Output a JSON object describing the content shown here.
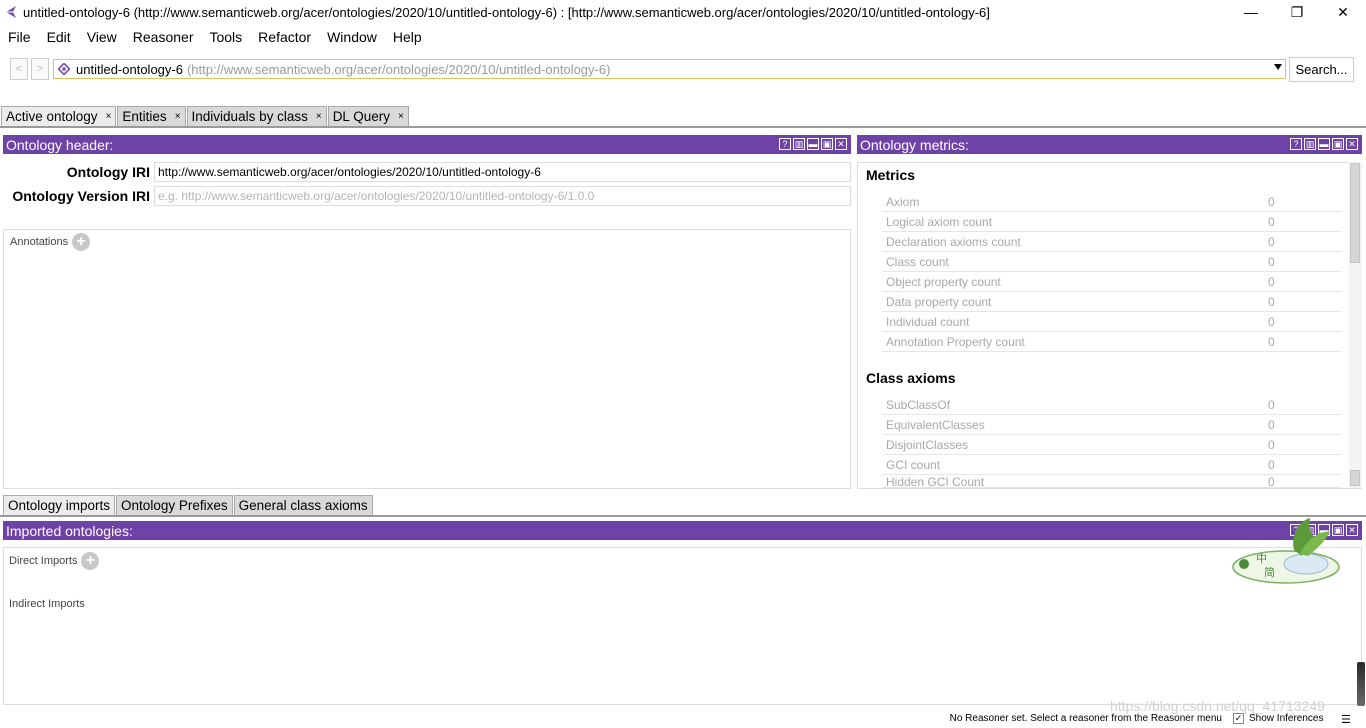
{
  "window": {
    "title": "untitled-ontology-6 (http://www.semanticweb.org/acer/ontologies/2020/10/untitled-ontology-6)  : [http://www.semanticweb.org/acer/ontologies/2020/10/untitled-ontology-6]",
    "controls": {
      "minimize": "—",
      "restore": "❐",
      "close": "✕"
    }
  },
  "menu": [
    "File",
    "Edit",
    "View",
    "Reasoner",
    "Tools",
    "Refactor",
    "Window",
    "Help"
  ],
  "nav": {
    "back": "<",
    "forward": ">",
    "ontology_name": "untitled-ontology-6",
    "ontology_iri": "(http://www.semanticweb.org/acer/ontologies/2020/10/untitled-ontology-6)",
    "search_label": "Search..."
  },
  "tabs": [
    {
      "label": "Active ontology",
      "close": "×"
    },
    {
      "label": "Entities",
      "close": "×"
    },
    {
      "label": "Individuals by class",
      "close": "×"
    },
    {
      "label": "DL Query",
      "close": "×"
    }
  ],
  "header_panel": {
    "title": "Ontology header:",
    "iri_label": "Ontology IRI",
    "iri_value": "http://www.semanticweb.org/acer/ontologies/2020/10/untitled-ontology-6",
    "version_label": "Ontology Version IRI",
    "version_placeholder": "e.g. http://www.semanticweb.org/acer/ontologies/2020/10/untitled-ontology-6/1.0.0",
    "annotations_label": "Annotations"
  },
  "metrics_panel": {
    "title": "Ontology metrics:",
    "metrics_heading": "Metrics",
    "metrics": [
      {
        "name": "Axiom",
        "value": "0"
      },
      {
        "name": "Logical axiom count",
        "value": "0"
      },
      {
        "name": "Declaration axioms count",
        "value": "0"
      },
      {
        "name": "Class count",
        "value": "0"
      },
      {
        "name": "Object property count",
        "value": "0"
      },
      {
        "name": "Data property count",
        "value": "0"
      },
      {
        "name": "Individual count",
        "value": "0"
      },
      {
        "name": "Annotation Property count",
        "value": "0"
      }
    ],
    "class_axioms_heading": "Class axioms",
    "class_axioms": [
      {
        "name": "SubClassOf",
        "value": "0"
      },
      {
        "name": "EquivalentClasses",
        "value": "0"
      },
      {
        "name": "DisjointClasses",
        "value": "0"
      },
      {
        "name": "GCI count",
        "value": "0"
      },
      {
        "name": "Hidden GCI Count",
        "value": "0"
      }
    ]
  },
  "bottom_tabs": [
    "Ontology imports",
    "Ontology Prefixes",
    "General class axioms"
  ],
  "imports_panel": {
    "title": "Imported ontologies:",
    "direct_label": "Direct Imports",
    "indirect_label": "Indirect Imports"
  },
  "status": {
    "message": "No Reasoner set. Select a reasoner from the Reasoner menu",
    "show_inferences": "Show Inferences",
    "watermark": "https://blog.csdn.net/qq_41713249"
  },
  "colors": {
    "panel_header": "#6f42a8",
    "selector_border": "#e0c060"
  }
}
